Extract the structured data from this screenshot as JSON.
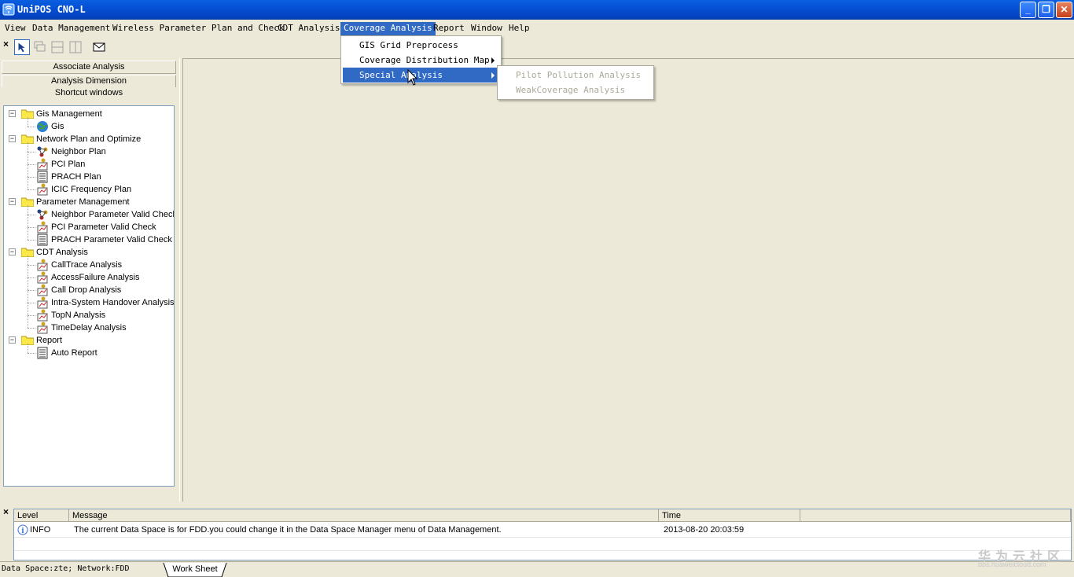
{
  "window": {
    "title": "UniPOS CNO-L"
  },
  "menubar": {
    "items": [
      "View",
      "Data Management",
      "Wireless Parameter Plan and Check",
      "CDT Analysis",
      "Coverage Analysis",
      "Report",
      "Window",
      "Help"
    ],
    "active": "Coverage Analysis"
  },
  "coverage_menu": {
    "items": [
      {
        "label": "GIS Grid Preprocess",
        "submenu": false
      },
      {
        "label": "Coverage Distribution Map",
        "submenu": true
      },
      {
        "label": "Special Analysis",
        "submenu": true,
        "highlighted": true
      }
    ]
  },
  "special_submenu": {
    "items": [
      "Pilot Pollution Analysis",
      "WeakCoverage Analysis"
    ]
  },
  "left_panel": {
    "tabs": [
      "Associate Analysis",
      "Analysis Dimension",
      "Shortcut windows"
    ],
    "tree": [
      {
        "label": "Gis Management",
        "children": [
          {
            "label": "Gis",
            "icon": "globe-icon"
          }
        ]
      },
      {
        "label": "Network Plan and Optimize",
        "children": [
          {
            "label": "Neighbor Plan",
            "icon": "network-icon"
          },
          {
            "label": "PCI Plan",
            "icon": "plan-icon"
          },
          {
            "label": "PRACH Plan",
            "icon": "form-icon"
          },
          {
            "label": "ICIC Frequency Plan",
            "icon": "plan-icon"
          }
        ]
      },
      {
        "label": "Parameter Management",
        "children": [
          {
            "label": "Neighbor Parameter Valid Check",
            "icon": "network-icon"
          },
          {
            "label": "PCI Parameter Valid Check",
            "icon": "plan-icon"
          },
          {
            "label": "PRACH Parameter Valid Check",
            "icon": "form-icon"
          }
        ]
      },
      {
        "label": "CDT Analysis",
        "children": [
          {
            "label": "CallTrace Analysis",
            "icon": "plan-icon"
          },
          {
            "label": "AccessFailure Analysis",
            "icon": "plan-icon"
          },
          {
            "label": "Call Drop Analysis",
            "icon": "plan-icon"
          },
          {
            "label": "Intra-System Handover Analysis",
            "icon": "plan-icon"
          },
          {
            "label": "TopN Analysis",
            "icon": "plan-icon"
          },
          {
            "label": "TimeDelay Analysis",
            "icon": "plan-icon"
          }
        ]
      },
      {
        "label": "Report",
        "children": [
          {
            "label": "Auto Report",
            "icon": "form-icon"
          }
        ]
      }
    ]
  },
  "messages": {
    "columns": [
      "Level",
      "Message",
      "Time"
    ],
    "rows": [
      {
        "level": "INFO",
        "message": "The current Data Space is for FDD.you could change it in the Data Space Manager menu of Data Management.",
        "time": "2013-08-20 20:03:59"
      }
    ]
  },
  "statusbar": {
    "text": "Data Space:zte; Network:FDD",
    "tab": "Work Sheet"
  },
  "watermark": {
    "text": "华为云社区",
    "url": "bbs.huaweicloud.com"
  },
  "colors": {
    "titlebar": "#0550d4",
    "highlight": "#316ac5",
    "face": "#ece9d8"
  }
}
